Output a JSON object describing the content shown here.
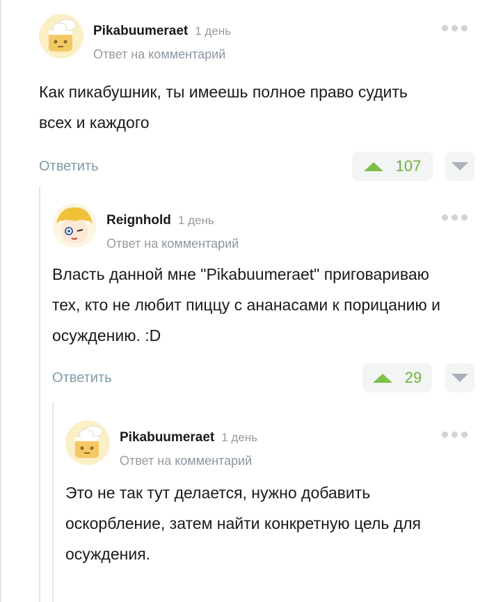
{
  "comments": [
    {
      "username": "Pikabuumeraet",
      "timestamp": "1 день",
      "reply_prefix": "Ответ на",
      "reply_link": "комментарий",
      "text": "Как пикабушник, ты имеешь полное право судить всех и каждого",
      "reply_label": "Ответить",
      "rating": "107",
      "avatar": "pikabu-chef-avatar-icon"
    },
    {
      "username": "Reignhold",
      "timestamp": "1 день",
      "reply_prefix": "Ответ на",
      "reply_link": "комментарий",
      "text": "Власть данной мне \"Pikabuumeraet\" приговариваю тех, кто не любит пиццу с ананасами к порицанию и осуждению. :D",
      "reply_label": "Ответить",
      "rating": "29",
      "avatar": "anime-girl-avatar-icon"
    },
    {
      "username": "Pikabuumeraet",
      "timestamp": "1 день",
      "reply_prefix": "Ответ на",
      "reply_link": "комментарий",
      "text": "Это не так тут делается, нужно добавить оскорбление, затем найти конкретную цель для осуждения.",
      "avatar": "pikabu-chef-avatar-icon"
    }
  ],
  "colors": {
    "upvote": "#7fbf4a",
    "reply_link": "#7f9aa8",
    "muted": "#9a9a9a"
  }
}
